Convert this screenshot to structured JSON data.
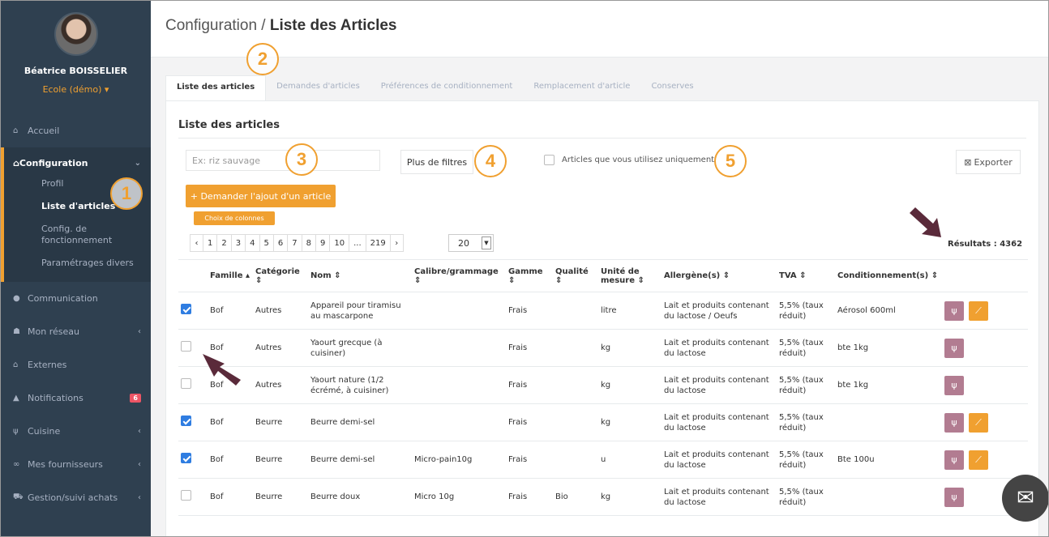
{
  "user": {
    "name": "Béatrice BOISSELIER",
    "org": "Ecole (démo) ▾"
  },
  "sidebar": {
    "home": "Accueil",
    "config": "Configuration",
    "config_sub": [
      "Profil",
      "Liste d'articles",
      "Config. de fonctionnement",
      "Paramétrages divers"
    ],
    "items": [
      {
        "label": "Communication",
        "chev": ""
      },
      {
        "label": "Mon réseau",
        "chev": "‹"
      },
      {
        "label": "Externes",
        "chev": ""
      },
      {
        "label": "Notifications",
        "badge": "6"
      },
      {
        "label": "Cuisine",
        "chev": "‹"
      },
      {
        "label": "Mes fournisseurs",
        "chev": "‹"
      },
      {
        "label": "Gestion/suivi achats",
        "chev": "‹"
      }
    ]
  },
  "header": {
    "crumb": "Configuration / ",
    "title": "Liste des Articles"
  },
  "tabs": [
    "Liste des articles",
    "Demandes d'articles",
    "Préférences de conditionnement",
    "Remplacement d'article",
    "Conserves"
  ],
  "panel": {
    "title": "Liste des articles",
    "search_placeholder": "Ex: riz sauvage",
    "more_filters": "Plus de filtres",
    "only_used": "Articles que vous utilisez uniquement",
    "export": "Exporter",
    "add_request": "+ Demander l'ajout d'un article",
    "columns": "Choix de colonnes",
    "pages": [
      "‹",
      "1",
      "2",
      "3",
      "4",
      "5",
      "6",
      "7",
      "8",
      "9",
      "10",
      "...",
      "219",
      "›"
    ],
    "page_size": "20",
    "results": "Résultats : 4362"
  },
  "table": {
    "headers": [
      "Famille ▴",
      "Catégorie ⇕",
      "Nom ⇕",
      "Calibre/grammage ⇕",
      "Gamme ⇕",
      "Qualité ⇕",
      "Unité de mesure ⇕",
      "Allergène(s) ⇕",
      "TVA ⇕",
      "Conditionnement(s) ⇕"
    ],
    "rows": [
      {
        "checked": true,
        "famille": "Bof",
        "categorie": "Autres",
        "nom": "Appareil pour tiramisu au mascarpone",
        "calibre": "",
        "gamme": "Frais",
        "qualite": "",
        "unite": "litre",
        "allergenes": "Lait et produits contenant du lactose / Oeufs",
        "tva": "5,5% (taux réduit)",
        "cond": "Aérosol 600ml",
        "chart": true
      },
      {
        "checked": false,
        "famille": "Bof",
        "categorie": "Autres",
        "nom": "Yaourt grecque (à cuisiner)",
        "calibre": "",
        "gamme": "Frais",
        "qualite": "",
        "unite": "kg",
        "allergenes": "Lait et produits contenant du lactose",
        "tva": "5,5% (taux réduit)",
        "cond": "bte 1kg",
        "chart": false
      },
      {
        "checked": false,
        "famille": "Bof",
        "categorie": "Autres",
        "nom": "Yaourt nature (1/2 écrémé, à cuisiner)",
        "calibre": "",
        "gamme": "Frais",
        "qualite": "",
        "unite": "kg",
        "allergenes": "Lait et produits contenant du lactose",
        "tva": "5,5% (taux réduit)",
        "cond": "bte 1kg",
        "chart": false
      },
      {
        "checked": true,
        "famille": "Bof",
        "categorie": "Beurre",
        "nom": "Beurre demi-sel",
        "calibre": "",
        "gamme": "Frais",
        "qualite": "",
        "unite": "kg",
        "allergenes": "Lait et produits contenant du lactose",
        "tva": "5,5% (taux réduit)",
        "cond": "",
        "chart": true
      },
      {
        "checked": true,
        "famille": "Bof",
        "categorie": "Beurre",
        "nom": "Beurre demi-sel",
        "calibre": "Micro-pain10g",
        "gamme": "Frais",
        "qualite": "",
        "unite": "u",
        "allergenes": "Lait et produits contenant du lactose",
        "tva": "5,5% (taux réduit)",
        "cond": "Bte 100u",
        "chart": true
      },
      {
        "checked": false,
        "famille": "Bof",
        "categorie": "Beurre",
        "nom": "Beurre doux",
        "calibre": "Micro 10g",
        "gamme": "Frais",
        "qualite": "Bio",
        "unite": "kg",
        "allergenes": "Lait et produits contenant du lactose",
        "tva": "5,5% (taux réduit)",
        "cond": "",
        "chart": false
      }
    ]
  },
  "callouts": [
    "1",
    "2",
    "3",
    "4",
    "5"
  ],
  "colors": {
    "sidebar": "#2f4050",
    "accent": "#f0a030",
    "checkbox": "#2f7de1",
    "fork_button": "#b27c91",
    "arrow": "#5a2a3a"
  }
}
